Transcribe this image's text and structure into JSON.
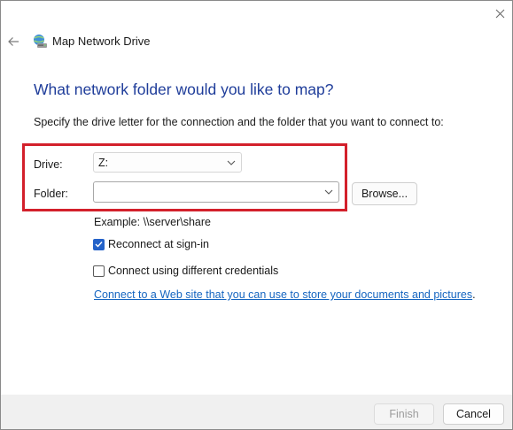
{
  "window": {
    "title": "Map Network Drive",
    "icons": {
      "close": "close-icon",
      "back": "back-arrow-icon",
      "title": "network-drive-icon"
    }
  },
  "main": {
    "heading": "What network folder would you like to map?",
    "instruction": "Specify the drive letter for the connection and the folder that you want to connect to:",
    "drive": {
      "label": "Drive:",
      "value": "Z:"
    },
    "folder": {
      "label": "Folder:",
      "value": "",
      "placeholder": ""
    },
    "browse_label": "Browse...",
    "example": "Example: \\\\server\\share",
    "reconnect": {
      "label": "Reconnect at sign-in",
      "checked": true
    },
    "different_credentials": {
      "label": "Connect using different credentials",
      "checked": false
    },
    "link": {
      "text": "Connect to a Web site that you can use to store your documents and pictures",
      "trailing": "."
    }
  },
  "footer": {
    "finish_label": "Finish",
    "finish_enabled": false,
    "cancel_label": "Cancel"
  },
  "colors": {
    "heading": "#1f3d9a",
    "link": "#1565c0",
    "checkbox_accent": "#2462c9",
    "highlight_border": "#d3202b",
    "footer_bg": "#f0f0f0"
  }
}
